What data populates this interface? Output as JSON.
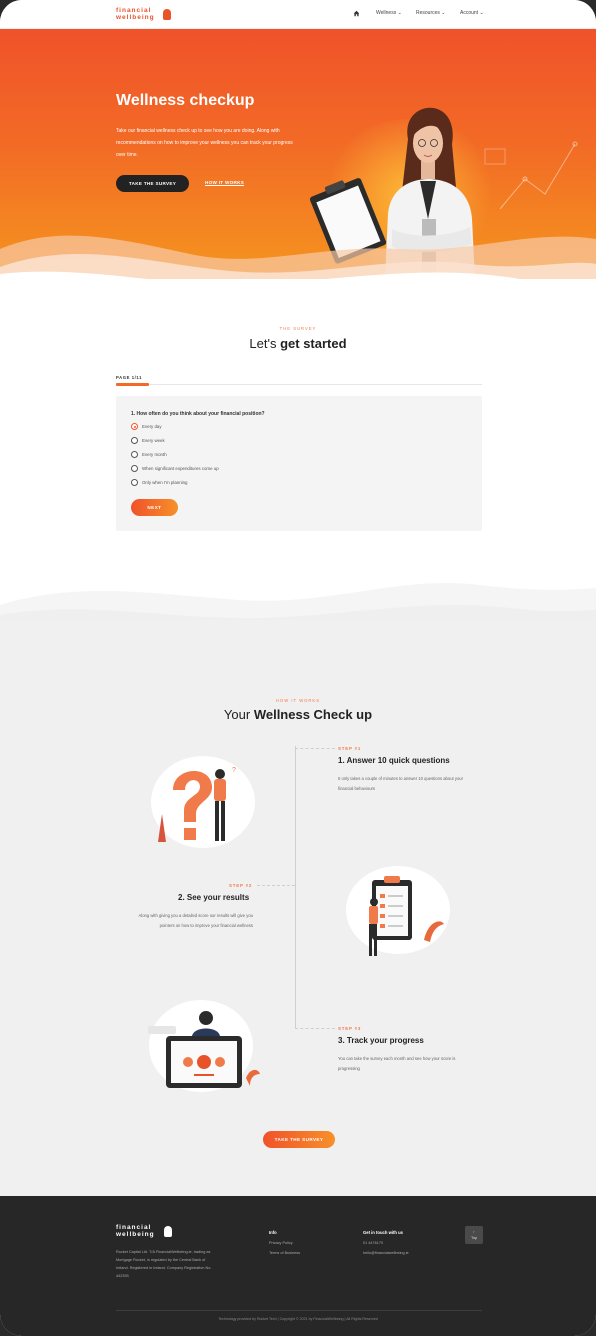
{
  "header": {
    "logo_line1": "financial",
    "logo_line2": "wellbeing",
    "nav": [
      "Wellness",
      "Resources",
      "Account"
    ]
  },
  "hero": {
    "title": "Wellness checkup",
    "text": "Take our financial wellness check up to see how you are doing. Along with recommendations on how to improve your wellness you can track your progress over time.",
    "primary_button": "TAKE THE SURVEY",
    "secondary_link": "HOW IT WORKS"
  },
  "survey": {
    "eyebrow": "THE SURVEY",
    "title_plain": "Let's ",
    "title_bold": "get started",
    "page_tab": "PAGE 1/11",
    "question": "1. How often do you think about your financial position?",
    "options": [
      "Every day",
      "Every week",
      "Every month",
      "When significant expenditures come up",
      "Only when I'm planning"
    ],
    "selected_option": "Every day",
    "next_button": "NEXT"
  },
  "how": {
    "eyebrow": "HOW IT WORKS",
    "title_plain": "Your ",
    "title_bold": "Wellness Check up",
    "steps": [
      {
        "label": "STEP #1",
        "title": "1. Answer 10 quick questions",
        "text": "It only takes a couple of minutes to answer 10 questions about your financial behaviours"
      },
      {
        "label": "STEP #2",
        "title": "2. See your results",
        "text": "Along with giving you a detailed score our results will give you pointers on how to improve your financial wellness"
      },
      {
        "label": "STEP #3",
        "title": "3. Track your progress",
        "text": "You can take the survey each month and see how your score is progressing"
      }
    ],
    "button": "TAKE THE SURVEY"
  },
  "footer": {
    "about": "Rocket Capital Ltd. T/A FinancialWellbeing.ie, trading as Mortgage Rocket, is regulated by the Central Bank of Ireland. Registered in Ireland. Company Registration No. 442393",
    "info_heading": "Info",
    "info_links": [
      "Privacy Policy",
      "Terms of Business"
    ],
    "contact_heading": "Get in touch with us",
    "contact_phone": "01 4476170",
    "contact_email": "hello@financialwellbeing.ie",
    "top_button_line1": "↑",
    "top_button_line2": "Top",
    "copyright": "Technology provided by Rocket Tech | Copyright © 2021 by FinancialWellbeing | All Rights Reserved"
  },
  "colors": {
    "accent": "#f26a26",
    "accent_dark": "#f0522a",
    "footer_bg": "#272727"
  }
}
